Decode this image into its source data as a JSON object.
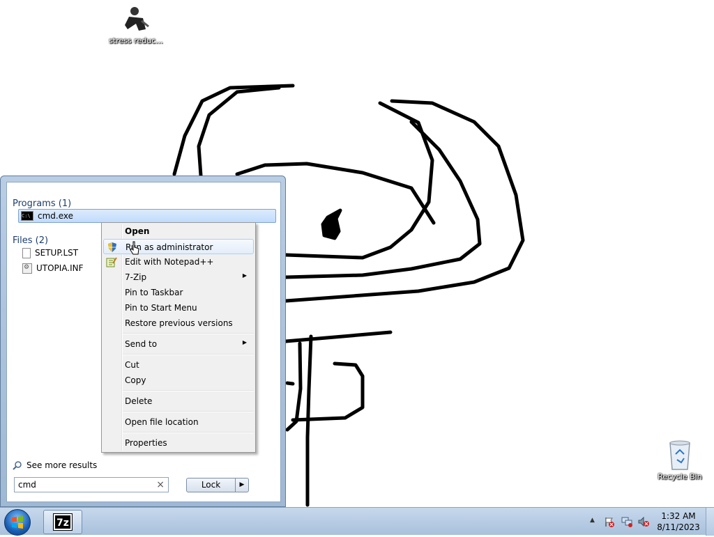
{
  "desktop": {
    "icons": [
      {
        "label": "stress reduc..."
      },
      {
        "label": "Recycle Bin"
      }
    ]
  },
  "start_menu": {
    "programs_header": "Programs (1)",
    "programs": [
      {
        "label": "cmd.exe"
      }
    ],
    "files_header": "Files (2)",
    "files": [
      {
        "label": "SETUP.LST"
      },
      {
        "label": "UTOPIA.INF"
      }
    ],
    "see_more": "See more results",
    "search": {
      "value": "cmd",
      "clear": "×"
    },
    "lock_label": "Lock",
    "lock_arrow": "▶"
  },
  "context_menu": {
    "items": [
      {
        "label": "Open"
      },
      {
        "label": "Run as administrator"
      },
      {
        "label": "Edit with Notepad++"
      },
      {
        "label": "7-Zip"
      },
      {
        "label": "Pin to Taskbar"
      },
      {
        "label": "Pin to Start Menu"
      },
      {
        "label": "Restore previous versions"
      },
      {
        "label": "Send to"
      },
      {
        "label": "Cut"
      },
      {
        "label": "Copy"
      },
      {
        "label": "Delete"
      },
      {
        "label": "Open file location"
      },
      {
        "label": "Properties"
      }
    ],
    "submenu_arrow": "▶"
  },
  "taskbar": {
    "pinned": [
      {
        "label": "7z"
      }
    ],
    "tray": {
      "show_hidden": "▲"
    },
    "clock": {
      "time": "1:32 AM",
      "date": "8/11/2023"
    }
  },
  "colors": {
    "accent": "#3399ff",
    "start_menu_bg": "#b9cde3",
    "taskbar_bg": "#b9cfe6"
  }
}
